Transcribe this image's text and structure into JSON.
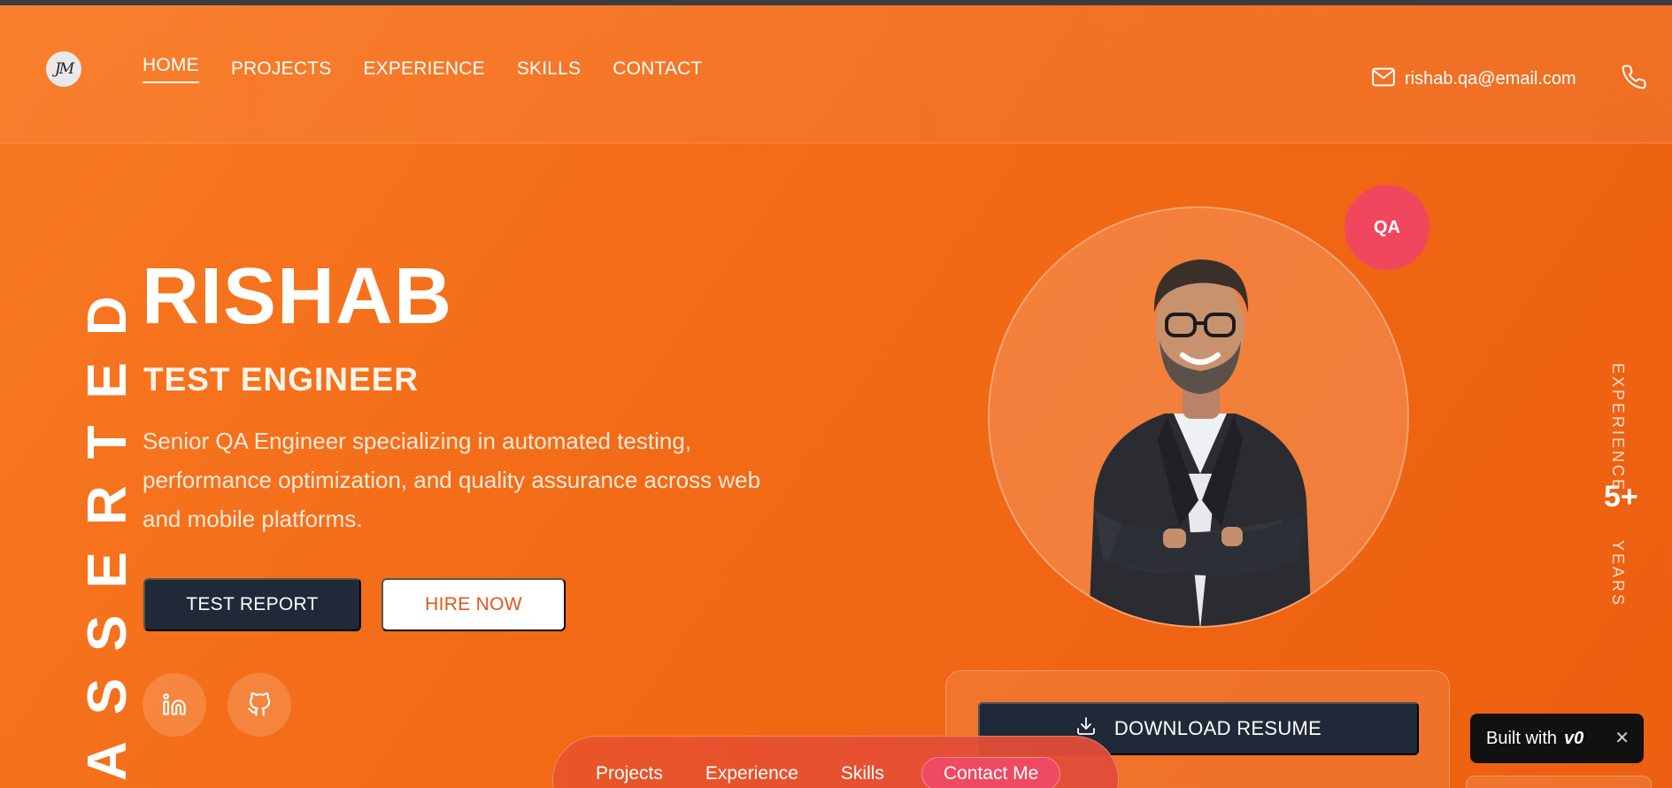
{
  "header": {
    "logo_text": "JM",
    "nav": [
      "HOME",
      "PROJECTS",
      "EXPERIENCE",
      "SKILLS",
      "CONTACT"
    ],
    "email": "rishab.qa@email.com"
  },
  "side_word": "ASSERTED",
  "hero": {
    "name": "RISHAB",
    "role": "TEST ENGINEER",
    "description": "Senior QA Engineer specializing in automated testing, performance optimization, and quality assurance across web and mobile platforms.",
    "primary_button": "TEST REPORT",
    "secondary_button": "HIRE NOW"
  },
  "badge": "QA",
  "experience": {
    "label_top": "EXPERIENCE",
    "value": "5+",
    "label_bottom": "YEARS"
  },
  "resume_button": "DOWNLOAD RESUME",
  "floating_nav": {
    "items": [
      "Projects",
      "Experience",
      "Skills"
    ],
    "cta": "Contact Me"
  },
  "built_with": {
    "text": "Built with",
    "brand": "v0",
    "close": "✕"
  },
  "colors": {
    "accent": "#f26a16",
    "dark": "#1f2937",
    "badge": "#f0475f"
  }
}
